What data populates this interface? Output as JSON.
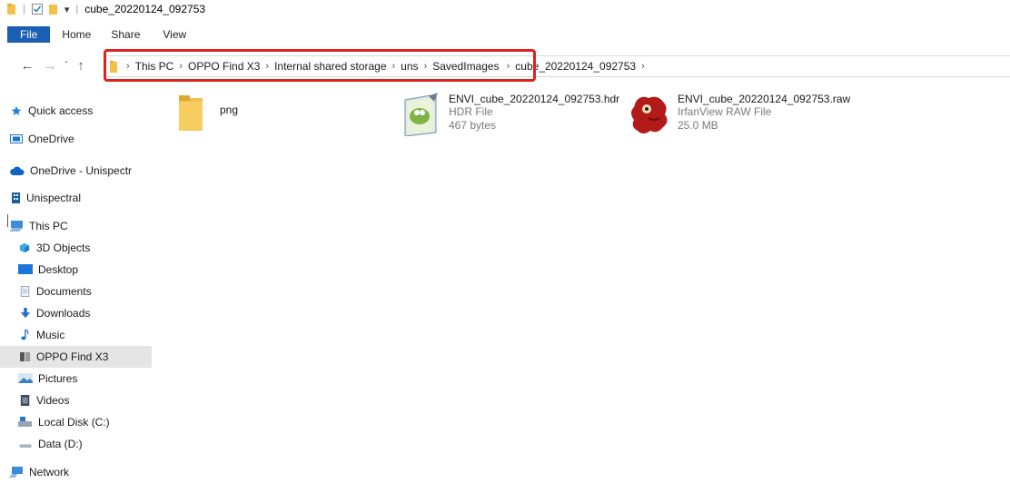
{
  "window": {
    "title": "cube_20220124_092753"
  },
  "ribbon": {
    "tabs": [
      "File",
      "Home",
      "Share",
      "View"
    ]
  },
  "address": {
    "crumbs": [
      "This PC",
      "OPPO Find X3",
      "Internal shared storage",
      "uns",
      "SavedImages",
      "cube_20220124_092753"
    ]
  },
  "sidebar": {
    "items": [
      {
        "label": "Quick access",
        "icon": "star-icon"
      },
      {
        "label": "OneDrive",
        "icon": "onedrive-icon"
      },
      {
        "label": "OneDrive - Unispectr",
        "icon": "cloud-icon"
      },
      {
        "label": "Unispectral",
        "icon": "building-icon"
      },
      {
        "label": "This PC",
        "icon": "computer-icon"
      },
      {
        "label": "3D Objects",
        "icon": "cube-icon"
      },
      {
        "label": "Desktop",
        "icon": "desktop-icon"
      },
      {
        "label": "Documents",
        "icon": "document-icon"
      },
      {
        "label": "Downloads",
        "icon": "download-icon"
      },
      {
        "label": "Music",
        "icon": "music-icon"
      },
      {
        "label": "OPPO Find X3",
        "icon": "phone-icon",
        "selected": true
      },
      {
        "label": "Pictures",
        "icon": "pictures-icon"
      },
      {
        "label": "Videos",
        "icon": "videos-icon"
      },
      {
        "label": "Local Disk (C:)",
        "icon": "disk-icon"
      },
      {
        "label": "Data (D:)",
        "icon": "drive-icon"
      },
      {
        "label": "Network",
        "icon": "network-icon"
      }
    ]
  },
  "files": [
    {
      "name": "png",
      "type": "",
      "size": "",
      "icon": "folder-icon"
    },
    {
      "name": "ENVI_cube_20220124_092753.hdr",
      "type": "HDR File",
      "size": "467 bytes",
      "icon": "notepad-icon"
    },
    {
      "name": "ENVI_cube_20220124_092753.raw",
      "type": "IrfanView RAW File",
      "size": "25.0 MB",
      "icon": "irfanview-icon"
    }
  ],
  "colors": {
    "accent": "#1a5fb4",
    "highlight": "#e02020",
    "folder": "#f3c04b",
    "selected": "#e5e5e5"
  }
}
